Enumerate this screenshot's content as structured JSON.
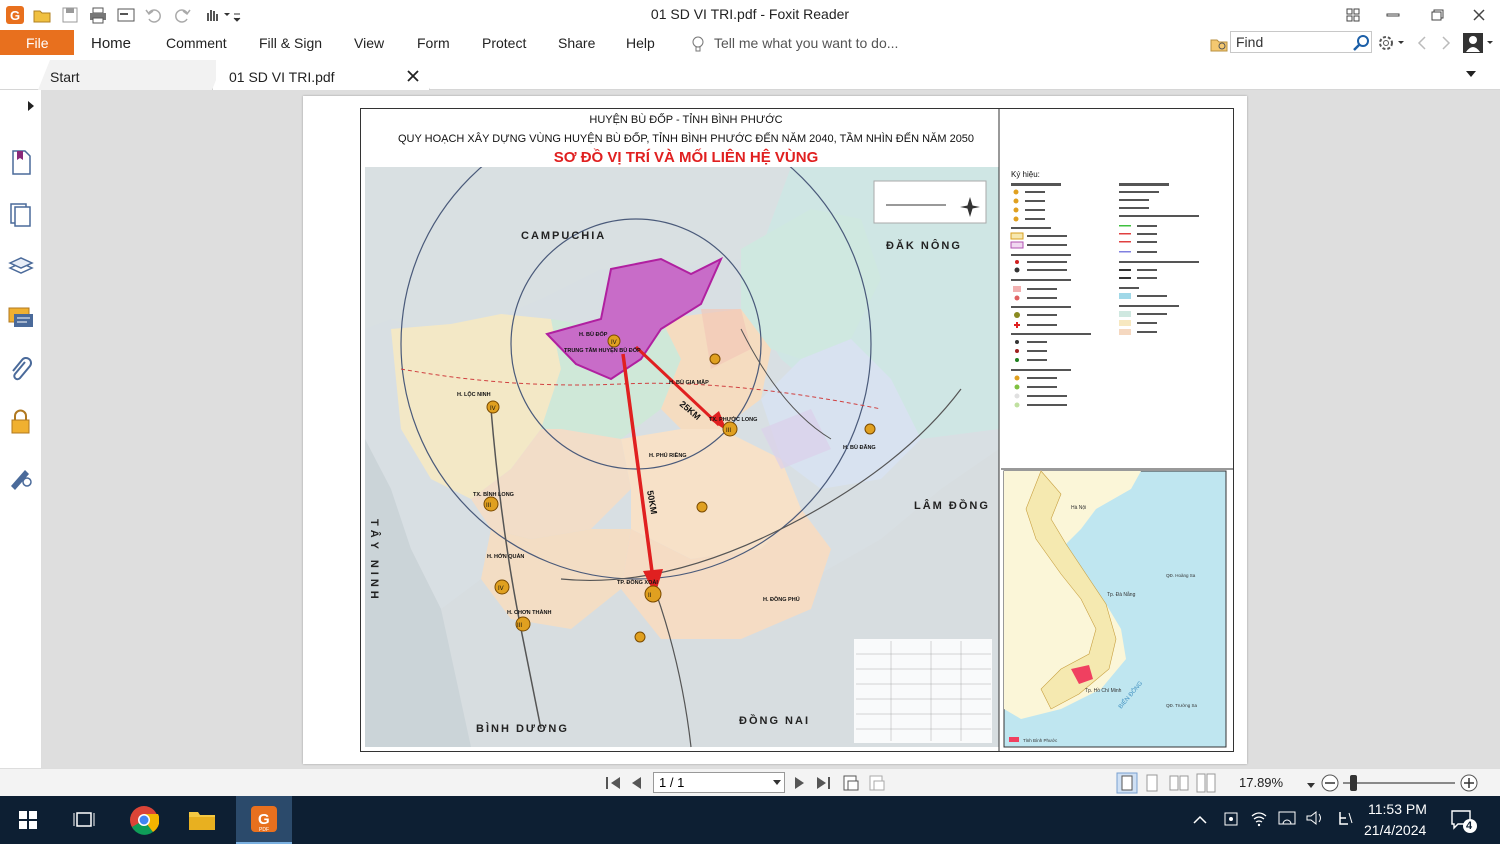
{
  "window": {
    "title": "01 SD VI TRI.pdf - Foxit Reader"
  },
  "menu": {
    "file": "File",
    "items": [
      "Home",
      "Comment",
      "Fill & Sign",
      "View",
      "Form",
      "Protect",
      "Share",
      "Help"
    ],
    "tell_me": "Tell me what you want to do...",
    "find_placeholder": "Find"
  },
  "tabs": {
    "start": "Start",
    "document": "01 SD VI TRI.pdf"
  },
  "map": {
    "header1": "HUYỆN BÙ ĐỐP - TỈNH BÌNH PHƯỚC",
    "header2": "QUY HOẠCH XÂY DỰNG VÙNG HUYỆN BÙ ĐỐP, TỈNH BÌNH PHƯỚC ĐẾN NĂM 2040, TẦM NHÌN ĐẾN NĂM 2050",
    "header3": "SƠ ĐỒ VỊ TRÍ VÀ MỐI LIÊN HỆ VÙNG",
    "regions": {
      "campuchia": "CAMPUCHIA",
      "dak_nong": "ĐĂK NÔNG",
      "lam_dong": "LÂM ĐỒNG",
      "tay_ninh": "TÂY NINH",
      "binh_duong": "BÌNH DƯƠNG",
      "dong_nai": "ĐỒNG NAI"
    },
    "places": {
      "bu_dop": "H. BÙ ĐỐP",
      "center": "TRUNG TÂM HUYỆN BÙ ĐỐP",
      "loc_ninh": "H. LỘC NINH",
      "bu_gia_map": "H. BÙ GIA MẬP",
      "phuoc_long": "TX. PHƯỚC LONG",
      "phu_rieng": "H. PHÚ RIỀNG",
      "bu_dang": "H. BÙ ĐĂNG",
      "binh_long": "TX. BÌNH LONG",
      "hon_quan": "H. HỚN QUẢN",
      "dong_xoai": "TP. ĐỒNG XOÀI",
      "chon_thanh": "H. CHƠN THÀNH",
      "dong_phu": "H. ĐỒNG PHÚ"
    },
    "distances": {
      "d25": "25KM",
      "d50": "50KM"
    },
    "legend_title": "Ký hiệu:",
    "inset": {
      "ha_noi": "Hà Nội",
      "da_nang": "Tp. Đà Nẵng",
      "hcm": "Tp. Hồ Chí Minh",
      "bien_dong": "BIỂN ĐÔNG",
      "hoang_sa": "QĐ. Hoàng Sa",
      "truong_sa": "QĐ. Trường Sa",
      "note": "Tỉnh Bình Phước"
    }
  },
  "statusbar": {
    "page": "1 / 1",
    "zoom": "17.89%"
  },
  "taskbar": {
    "time": "11:53 PM",
    "date": "21/4/2024",
    "notifications": "4"
  },
  "colors": {
    "accent": "#e8701e",
    "taskbar": "#0d1f33",
    "arrow": "#e02020",
    "bu_dop_fill": "#c86cc8"
  }
}
